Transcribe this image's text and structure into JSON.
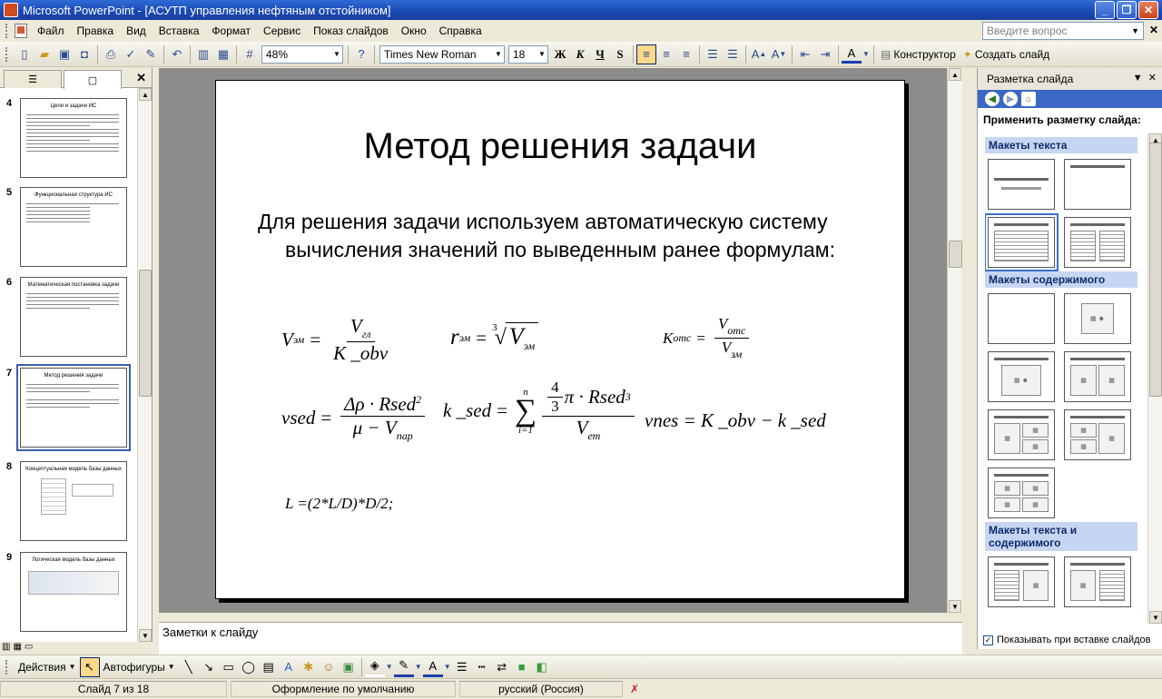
{
  "window": {
    "title": "Microsoft PowerPoint - [АСУТП управления нефтяным отстойником]"
  },
  "menu": {
    "items": [
      "Файл",
      "Правка",
      "Вид",
      "Вставка",
      "Формат",
      "Сервис",
      "Показ слайдов",
      "Окно",
      "Справка"
    ],
    "help_placeholder": "Введите вопрос"
  },
  "toolbar": {
    "zoom": "48%",
    "font_name": "Times New Roman",
    "font_size": "18",
    "bold": "Ж",
    "italic": "К",
    "underline": "Ч",
    "shadow": "S",
    "designer": "Конструктор",
    "new_slide": "Создать слайд"
  },
  "thumbnails": [
    {
      "num": "4",
      "title": "Цели и задачи ИС"
    },
    {
      "num": "5",
      "title": "Функциональная структура ИС"
    },
    {
      "num": "6",
      "title": "Математическая постановка задачи"
    },
    {
      "num": "7",
      "title": "Метод решения задачи"
    },
    {
      "num": "8",
      "title": "Концептуальная модель базы данных"
    },
    {
      "num": "9",
      "title": "Логическая модель базы данных"
    }
  ],
  "slide": {
    "title": "Метод решения задачи",
    "body": "Для решения задачи используем автоматическую систему вычисления значений по выведенным ранее формулам:",
    "formulas": {
      "f1": {
        "lhs": "V",
        "lhs_sub": "эм",
        "num": "V",
        "num_sub": "гл",
        "den": "K _obv"
      },
      "f2": {
        "lhs": "r",
        "lhs_sub": "эм",
        "root_index": "3",
        "radicand": "V",
        "radicand_sub": "эм"
      },
      "f3": {
        "lhs": "K",
        "lhs_sub": "отс",
        "num": "V",
        "num_sub": "отс",
        "den": "V",
        "den_sub": "зм"
      },
      "f4": {
        "lhs": "vsed",
        "num": "Δρ · Rsed",
        "num_sup": "2",
        "den": "μ − V",
        "den_sub": "пар"
      },
      "f5": {
        "lhs": "k _sed",
        "sum_top": "n",
        "sum_bottom": "i=1",
        "coef_num": "4",
        "coef_den": "3",
        "num_tail": "π · Rsed",
        "num_sup": "3",
        "den": "V",
        "den_sub": "ет"
      },
      "f6": {
        "text": "vnes = K _obv − k _sed"
      },
      "f7": {
        "text": "L =(2*L/D)*D/2;"
      }
    }
  },
  "notes": {
    "placeholder": "Заметки к слайду"
  },
  "taskpane": {
    "title": "Разметка слайда",
    "apply_label": "Применить разметку слайда:",
    "sections": [
      "Макеты текста",
      "Макеты содержимого",
      "Макеты текста и содержимого"
    ],
    "show_on_insert": "Показывать при вставке слайдов"
  },
  "drawbar": {
    "actions": "Действия",
    "autoshapes": "Автофигуры"
  },
  "status": {
    "slide": "Слайд 7 из 18",
    "design": "Оформление по умолчанию",
    "language": "русский (Россия)"
  }
}
